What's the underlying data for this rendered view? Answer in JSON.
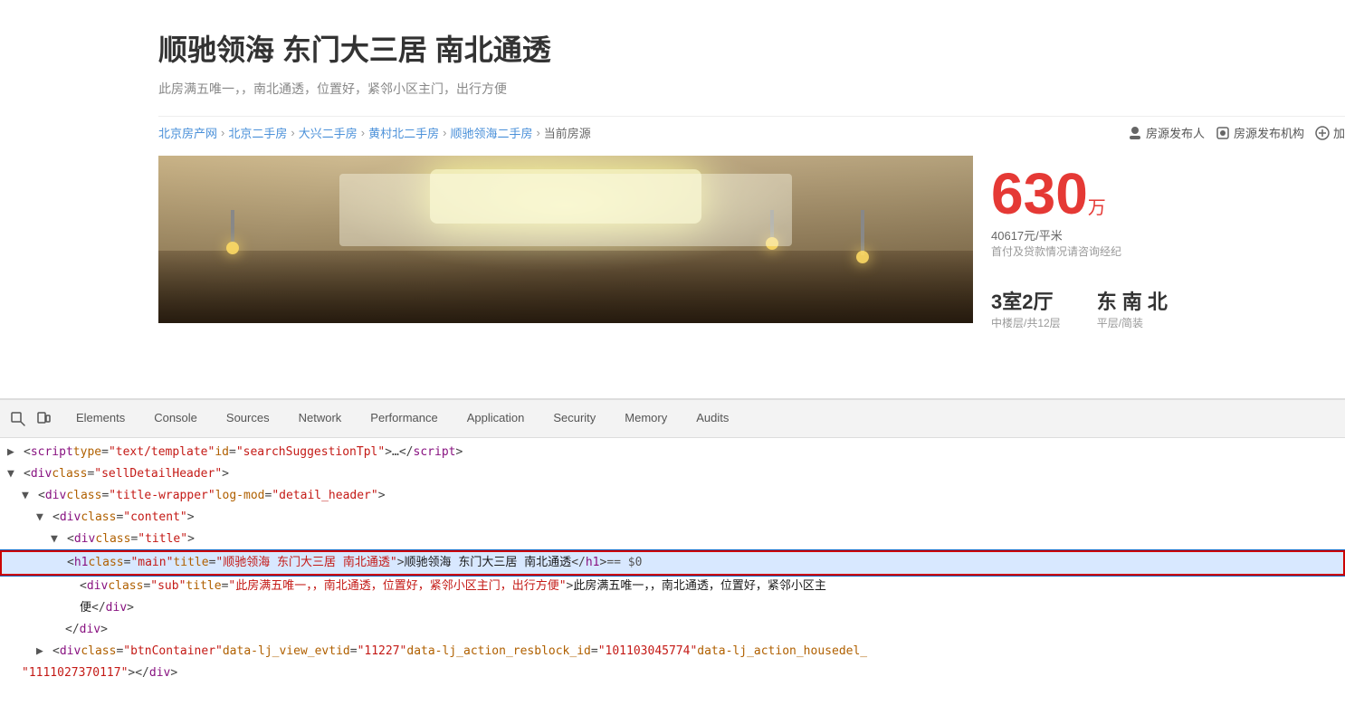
{
  "page": {
    "title": "顺驰领海 东门大三居 南北通透",
    "subtitle": "此房满五唯一，，南北通透，位置好，紧邻小区主门，出行方便",
    "price": "630",
    "price_unit": "万",
    "price_per": "40617元/平米",
    "price_note": "首付及贷款情况请咨询经纪",
    "room_info": "3室2厅",
    "direction": "东 南 北",
    "floor": "中楼层/共12层",
    "decoration": "平层/简装"
  },
  "breadcrumb": {
    "items": [
      "北京房产网",
      "北京二手房",
      "大兴二手房",
      "黄村北二手房",
      "顺驰领海二手房",
      "当前房源"
    ]
  },
  "right_icons": {
    "publisher_label": "房源发布人",
    "org_label": "房源发布机构",
    "add_label": "加"
  },
  "devtools": {
    "tabs": [
      {
        "id": "elements",
        "label": "Elements",
        "active": false
      },
      {
        "id": "console",
        "label": "Console",
        "active": false
      },
      {
        "id": "sources",
        "label": "Sources",
        "active": false
      },
      {
        "id": "network",
        "label": "Network",
        "active": false
      },
      {
        "id": "performance",
        "label": "Performance",
        "active": false
      },
      {
        "id": "application",
        "label": "Application",
        "active": false
      },
      {
        "id": "security",
        "label": "Security",
        "active": false
      },
      {
        "id": "memory",
        "label": "Memory",
        "active": false
      },
      {
        "id": "audits",
        "label": "Audits",
        "active": false
      }
    ],
    "code_lines": [
      {
        "indent": 0,
        "arrow": "▶",
        "content": "&lt;script type=\"text/template\" id=\"searchSuggestionTpl\"&gt;…&lt;/script&gt;"
      },
      {
        "indent": 0,
        "arrow": "▼",
        "content": "&lt;div class=\"sellDetailHeader\"&gt;"
      },
      {
        "indent": 1,
        "arrow": "▼",
        "content": "&lt;div class=\"title-wrapper\" log-mod=\"detail_header\"&gt;"
      },
      {
        "indent": 2,
        "arrow": "▼",
        "content": "&lt;div class=\"content\"&gt;"
      },
      {
        "indent": 3,
        "arrow": "▼",
        "content": "&lt;div class=\"title\"&gt;"
      },
      {
        "indent": 4,
        "selected": true,
        "content": "<h1 class=\"main\" title=\"顺驰领海 东门大三居 南北通透\">顺驰领海 东门大三居 南北通透</h1> == $0"
      },
      {
        "indent": 4,
        "content": "&lt;div class=\"sub\" title=\"此房满五唯一，，南北通透，位置好，紧邻小区主门，出行方便\"&gt;此房满五唯一，，南北通透，位置好，紧邻小区主"
      },
      {
        "indent": 4,
        "content": "便&lt;/div&gt;"
      },
      {
        "indent": 3,
        "content": "&lt;/div&gt;"
      },
      {
        "indent": 2,
        "arrow": "▶",
        "content": "&lt;div class=\"btnContainer\" data-lj_view_evtid=\"11227\" data-lj_action_resblock_id=\"101103045774\" data-lj_action_housedel_"
      },
      {
        "indent": 2,
        "content": "\"1111027370117\"&gt;&lt;/div&gt;"
      }
    ]
  }
}
